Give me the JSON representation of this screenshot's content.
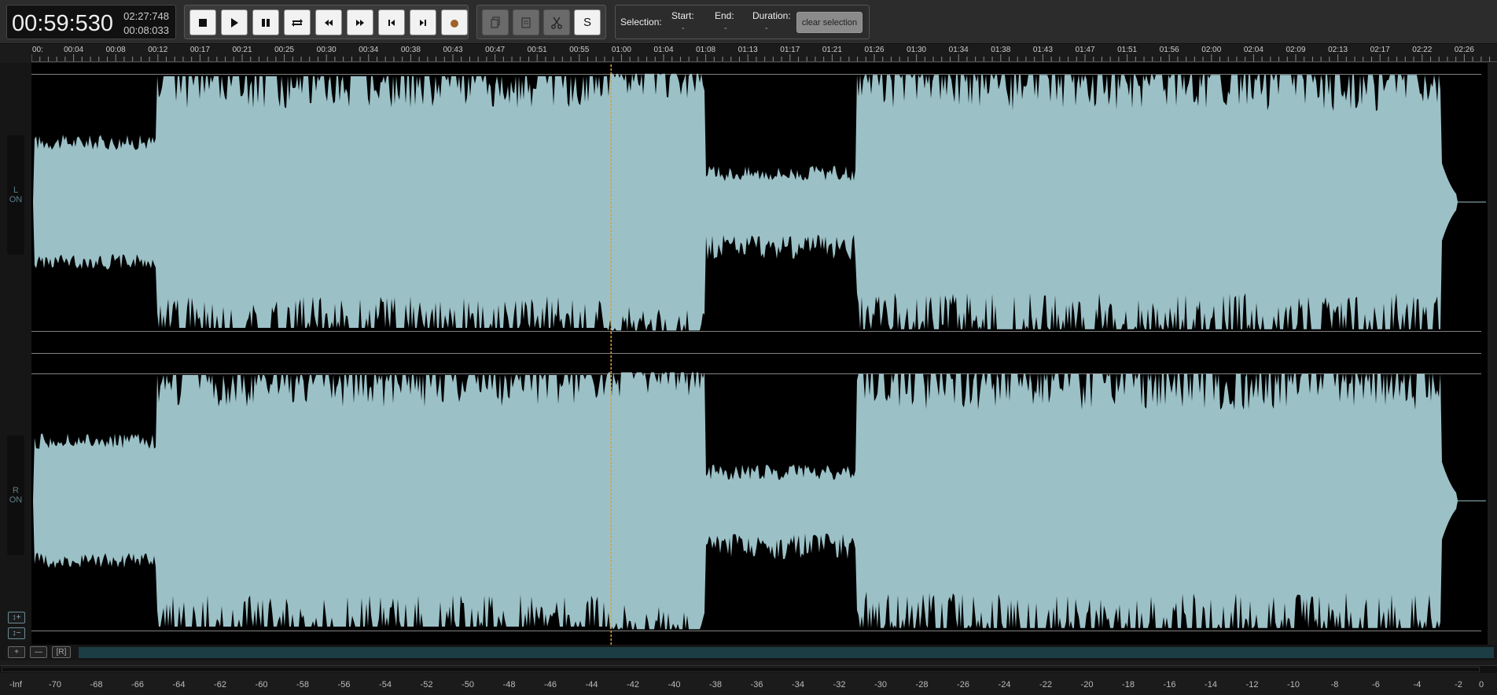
{
  "time": {
    "current": "00:59:530",
    "total": "02:27:748",
    "selection": "00:08:033"
  },
  "transport": {
    "buttons": [
      {
        "name": "stop-button",
        "icon": "stop-icon"
      },
      {
        "name": "play-button",
        "icon": "play-icon"
      },
      {
        "name": "pause-button",
        "icon": "pause-icon"
      },
      {
        "name": "loop-button",
        "icon": "loop-icon"
      },
      {
        "name": "rewind-button",
        "icon": "rewind-icon"
      },
      {
        "name": "fast-forward-button",
        "icon": "fast-forward-icon"
      },
      {
        "name": "skip-to-start-button",
        "icon": "skip-start-icon"
      },
      {
        "name": "skip-to-end-button",
        "icon": "skip-end-icon"
      },
      {
        "name": "record-button",
        "icon": "record-icon"
      }
    ]
  },
  "edit": {
    "buttons": [
      {
        "name": "copy-button",
        "icon": "copy-icon",
        "enabled": false
      },
      {
        "name": "paste-button",
        "icon": "paste-icon",
        "enabled": false
      },
      {
        "name": "cut-button",
        "icon": "scissors-icon",
        "enabled": false
      },
      {
        "name": "silence-button",
        "label": "S",
        "enabled": true
      }
    ]
  },
  "selection": {
    "label": "Selection:",
    "start_label": "Start:",
    "start_value": "-",
    "end_label": "End:",
    "end_value": "-",
    "duration_label": "Duration:",
    "duration_value": "-",
    "clear_label": "clear selection"
  },
  "ruler": {
    "labels": [
      "00:",
      "00:04",
      "00:08",
      "00:12",
      "00:17",
      "00:21",
      "00:25",
      "00:30",
      "00:34",
      "00:38",
      "00:43",
      "00:47",
      "00:51",
      "00:55",
      "01:00",
      "01:04",
      "01:08",
      "01:13",
      "01:17",
      "01:21",
      "01:26",
      "01:30",
      "01:34",
      "01:38",
      "01:43",
      "01:47",
      "01:51",
      "01:56",
      "02:00",
      "02:04",
      "02:09",
      "02:13",
      "02:17",
      "02:22",
      "02:26"
    ]
  },
  "playhead_seconds": 59.53,
  "duration_seconds": 147.748,
  "channels": [
    {
      "letter": "L",
      "state": "ON"
    },
    {
      "letter": "R",
      "state": "ON"
    }
  ],
  "zoom": {
    "in_label": "↕+",
    "out_label": "↕−"
  },
  "track_controls": {
    "add_label": "+",
    "remove_label": "—",
    "r_label": "[R]"
  },
  "db_scale": {
    "labels": [
      "-Inf",
      "-70",
      "-68",
      "-66",
      "-64",
      "-62",
      "-60",
      "-58",
      "-56",
      "-54",
      "-52",
      "-50",
      "-48",
      "-46",
      "-44",
      "-42",
      "-40",
      "-38",
      "-36",
      "-34",
      "-32",
      "-30",
      "-28",
      "-26",
      "-24",
      "-22",
      "-20",
      "-18",
      "-16",
      "-14",
      "-12",
      "-10",
      "-8",
      "-6",
      "-4",
      "-2",
      "0"
    ]
  },
  "colors": {
    "waveform": "#9bc1c7",
    "playhead": "#e0a030",
    "background": "#000000",
    "overview": "#1c3d44",
    "record": "#a0602a"
  }
}
